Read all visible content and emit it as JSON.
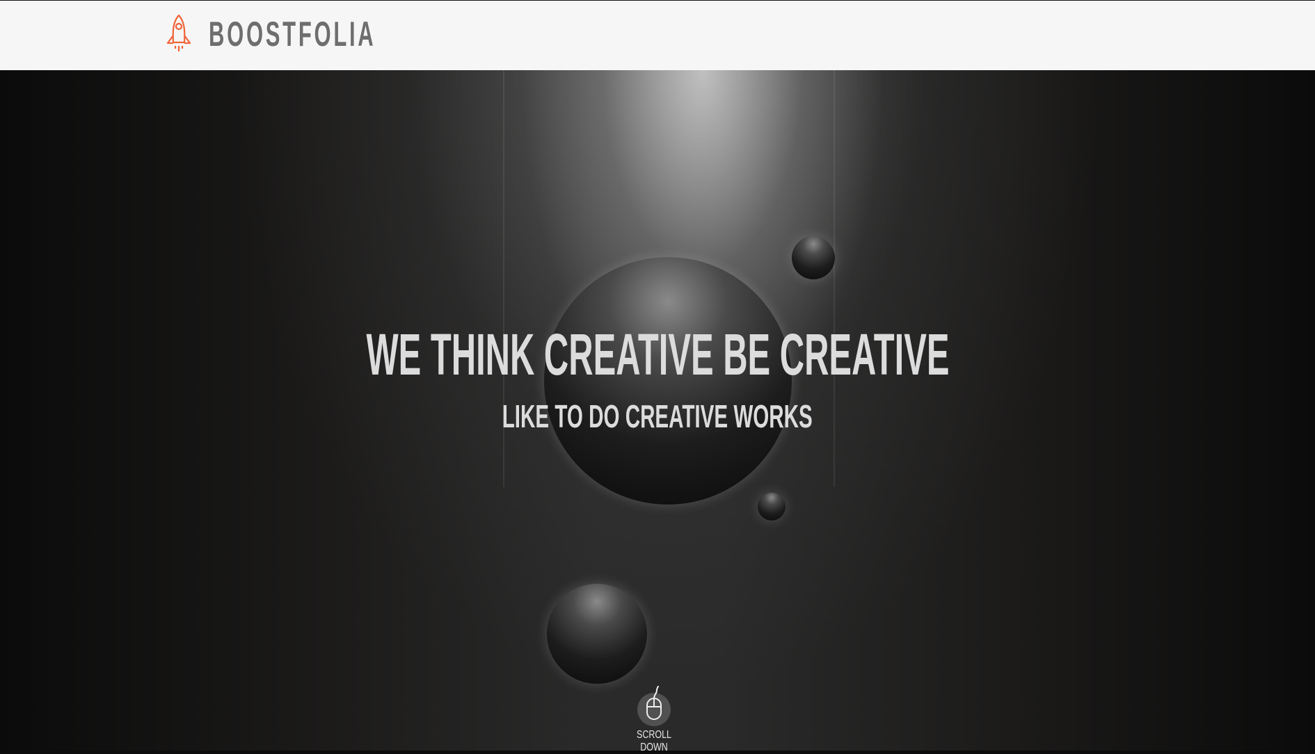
{
  "header": {
    "brand": "BOOSTFOLIA",
    "logo_icon": "rocket-icon",
    "logo_color": "#f0643a"
  },
  "hero": {
    "headline": "WE THINK CREATIVE BE CREATIVE",
    "subheadline": "LIKE TO DO CREATIVE WORKS",
    "scroll_icon": "mouse-icon",
    "scroll_label": "SCROLL DOWN"
  }
}
